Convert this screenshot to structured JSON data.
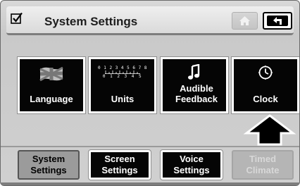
{
  "header": {
    "title": "System Settings",
    "check_icon": "checkbox-checked-icon",
    "home_icon": "home-icon",
    "back_icon": "back-arrow-icon"
  },
  "tiles": [
    {
      "label": "Language",
      "icon": "flag-icon"
    },
    {
      "label": "Units",
      "icon": "ruler-icon",
      "ruler_top": "0 1 2 3 4 5 6 7 8",
      "ruler_bottom": "0 1 2 3 4 5"
    },
    {
      "label": "Audible Feedback",
      "icon": "music-note-icon"
    },
    {
      "label": "Clock",
      "icon": "clock-icon"
    }
  ],
  "tabs": [
    {
      "label": "System Settings",
      "state": "active"
    },
    {
      "label": "Screen Settings",
      "state": "normal"
    },
    {
      "label": "Voice Settings",
      "state": "normal"
    },
    {
      "label": "Timed Climate",
      "state": "disabled"
    }
  ],
  "pointer_icon": "up-arrow-pointer-icon"
}
